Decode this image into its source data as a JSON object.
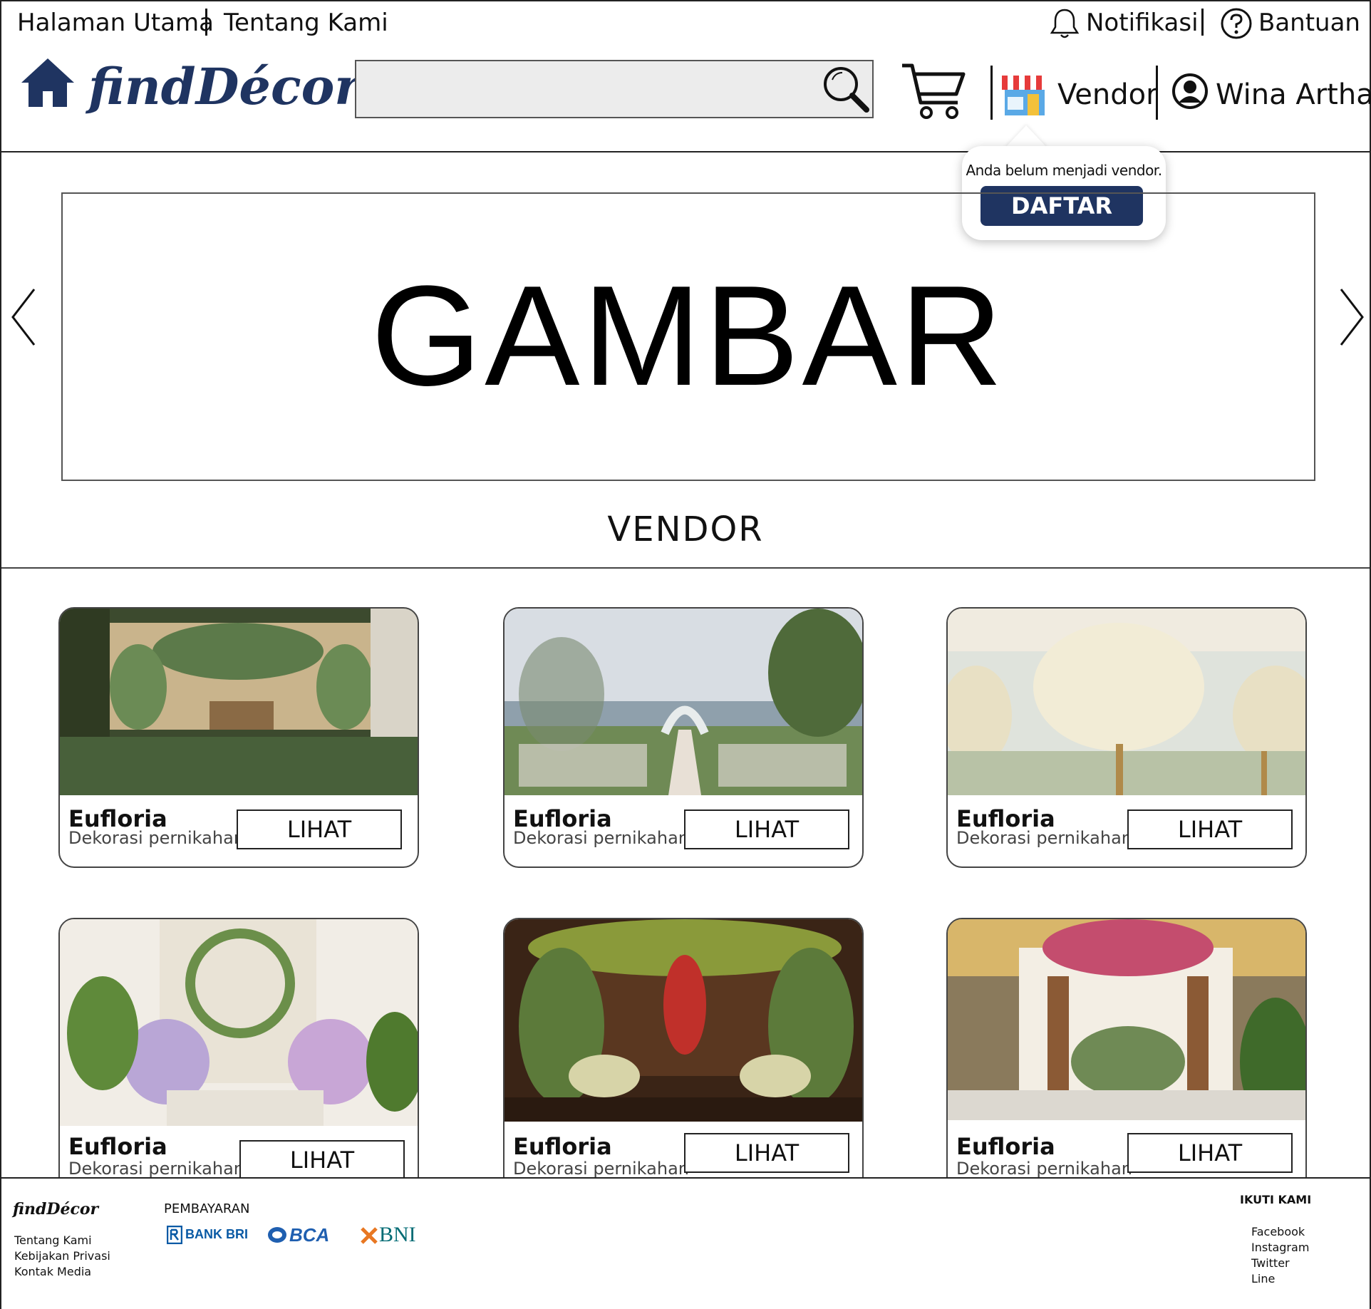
{
  "header": {
    "nav_home": "Halaman Utama",
    "nav_about": "Tentang Kami",
    "notifications": "Notifikasi",
    "help": "Bantuan",
    "logo": "findDécor",
    "search_placeholder": "",
    "vendor": "Vendor",
    "user_name": "Wina Artha"
  },
  "vendor_tooltip": {
    "message": "Anda belum menjadi vendor.",
    "button": "DAFTAR"
  },
  "banner": {
    "text": "GAMBAR"
  },
  "section": {
    "title": "VENDOR"
  },
  "cards": [
    {
      "name": "Eufloria",
      "category": "Dekorasi pernikahan",
      "button": "LIHAT"
    },
    {
      "name": "Eufloria",
      "category": "Dekorasi pernikahan",
      "button": "LIHAT"
    },
    {
      "name": "Eufloria",
      "category": "Dekorasi pernikahan",
      "button": "LIHAT"
    },
    {
      "name": "Eufloria",
      "category": "Dekorasi pernikahan",
      "button": "LIHAT"
    },
    {
      "name": "Eufloria",
      "category": "Dekorasi pernikahan",
      "button": "LIHAT"
    },
    {
      "name": "Eufloria",
      "category": "Dekorasi pernikahan",
      "button": "LIHAT"
    }
  ],
  "footer": {
    "logo": "findDécor",
    "links": [
      "Tentang Kami",
      "Kebijakan Privasi",
      "Kontak Media"
    ],
    "payment_title": "PEMBAYARAN",
    "payments": [
      "BANK BRI",
      "BCA",
      "BNI"
    ],
    "follow_title": "IKUTI KAMI",
    "social": [
      "Facebook",
      "Instagram",
      "Twitter",
      "Line"
    ]
  },
  "colors": {
    "brand": "#1f3461",
    "bri": "#0a5aa5",
    "bni_orange": "#e87722",
    "bni_teal": "#006b74"
  },
  "icons": [
    "bell-icon",
    "help-icon",
    "home-icon",
    "search-icon",
    "cart-icon",
    "store-icon",
    "user-icon",
    "chevron-left-icon",
    "chevron-right-icon"
  ]
}
